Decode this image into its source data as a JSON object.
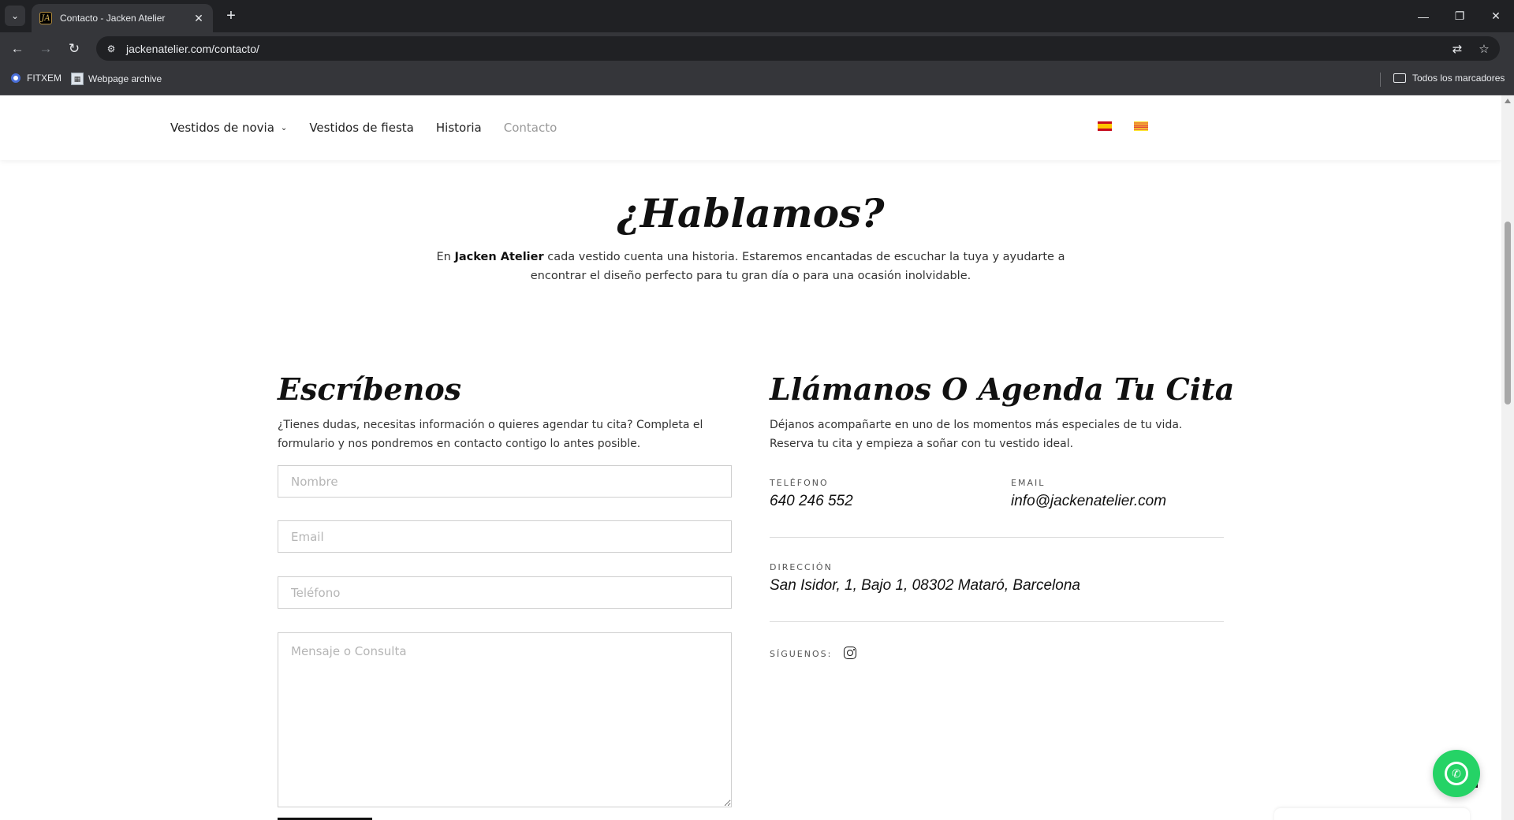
{
  "browser": {
    "tab_title": "Contacto - Jacken Atelier",
    "favicon_text": "JA",
    "url": "jackenatelier.com/contacto/",
    "bookmarks": [
      {
        "label": "FITXEM"
      },
      {
        "label": "Webpage archive"
      }
    ],
    "all_bookmarks_label": "Todos los marcadores"
  },
  "nav": {
    "items": [
      {
        "label": "Vestidos de novia",
        "has_dropdown": true
      },
      {
        "label": "Vestidos de fiesta"
      },
      {
        "label": "Historia"
      },
      {
        "label": "Contacto",
        "active": true
      }
    ]
  },
  "hero": {
    "title": "¿Hablamos?",
    "text_before": "En ",
    "brand": "Jacken Atelier",
    "text_after": " cada vestido cuenta una historia. Estaremos encantadas de escuchar la tuya y ayudarte a encontrar el diseño perfecto para tu gran día o para una ocasión inolvidable."
  },
  "form": {
    "title": "Escríbenos",
    "description": "¿Tienes dudas, necesitas información o quieres agendar tu cita? Completa el formulario y nos pondremos en contacto contigo lo antes posible.",
    "name_placeholder": "Nombre",
    "email_placeholder": "Email",
    "phone_placeholder": "Teléfono",
    "message_placeholder": "Mensaje o Consulta"
  },
  "contact": {
    "title": "Llámanos O Agenda Tu Cita",
    "description": "Déjanos acompañarte en uno de los momentos más especiales de tu vida. Reserva tu cita y empieza a soñar con tu vestido ideal.",
    "phone_label": "TELÉFONO",
    "phone": "640 246 552",
    "email_label": "EMAIL",
    "email": "info@jackenatelier.com",
    "address_label": "DIRECCIÓN",
    "address": "San Isidor, 1, Bajo 1, 08302 Mataró, Barcelona",
    "follow_label": "SÍGUENOS:"
  },
  "colors": {
    "whatsapp": "#25d366",
    "chrome_dark": "#202124",
    "chrome_toolbar": "#35363a"
  }
}
